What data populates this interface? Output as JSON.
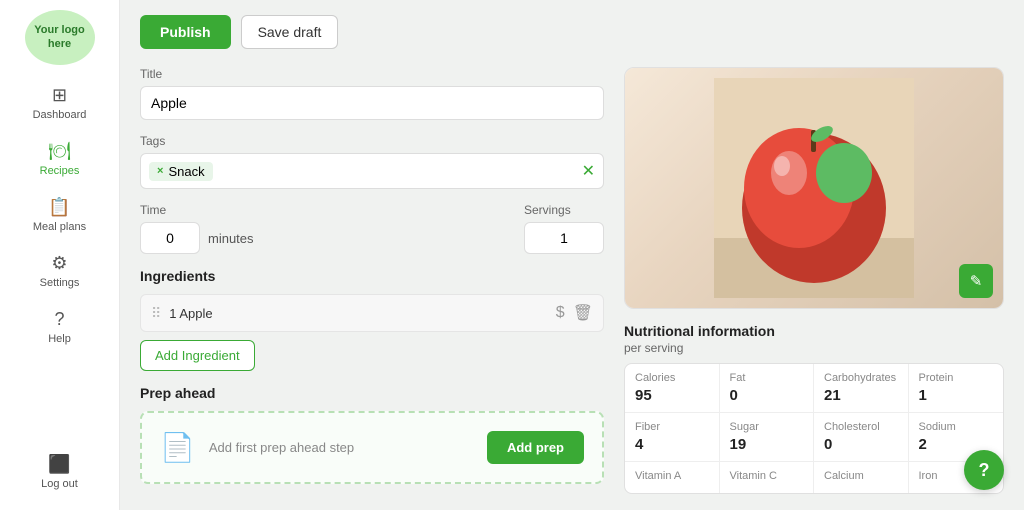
{
  "logo": {
    "text": "Your logo here"
  },
  "sidebar": {
    "items": [
      {
        "id": "dashboard",
        "label": "Dashboard",
        "icon": "⊞",
        "active": false
      },
      {
        "id": "recipes",
        "label": "Recipes",
        "icon": "🍽",
        "active": true
      },
      {
        "id": "mealplans",
        "label": "Meal plans",
        "icon": "📋",
        "active": false
      },
      {
        "id": "settings",
        "label": "Settings",
        "icon": "⚙",
        "active": false
      },
      {
        "id": "help",
        "label": "Help",
        "icon": "?",
        "active": false
      },
      {
        "id": "logout",
        "label": "Log out",
        "icon": "→",
        "active": false
      }
    ]
  },
  "toolbar": {
    "publish_label": "Publish",
    "save_draft_label": "Save draft"
  },
  "form": {
    "title_label": "Title",
    "title_value": "Apple",
    "title_placeholder": "",
    "tags_label": "Tags",
    "tags": [
      {
        "text": "Snack"
      }
    ],
    "tags_add_icon": "✕",
    "time_label": "Time",
    "time_value": "0",
    "minutes_label": "minutes",
    "servings_label": "Servings",
    "servings_value": "1"
  },
  "ingredients": {
    "section_title": "Ingredients",
    "items": [
      {
        "text": "1 Apple"
      }
    ],
    "add_button_label": "Add Ingredient"
  },
  "prep_ahead": {
    "section_title": "Prep ahead",
    "empty_text": "Add first prep ahead step",
    "add_button_label": "Add prep"
  },
  "image": {
    "edit_icon": "✎"
  },
  "nutrition": {
    "title": "Nutritional information",
    "per_serving": "per serving",
    "rows": [
      [
        {
          "label": "Calories",
          "value": "95"
        },
        {
          "label": "Fat",
          "value": "0"
        },
        {
          "label": "Carbohydrates",
          "value": "21"
        },
        {
          "label": "Protein",
          "value": "1"
        }
      ],
      [
        {
          "label": "Fiber",
          "value": "4"
        },
        {
          "label": "Sugar",
          "value": "19"
        },
        {
          "label": "Cholesterol",
          "value": "0"
        },
        {
          "label": "Sodium",
          "value": "2"
        }
      ],
      [
        {
          "label": "Vitamin A",
          "value": ""
        },
        {
          "label": "Vitamin C",
          "value": ""
        },
        {
          "label": "Calcium",
          "value": ""
        },
        {
          "label": "Iron",
          "value": ""
        }
      ]
    ]
  },
  "help_fab": {
    "label": "?"
  },
  "colors": {
    "green": "#3aaa35",
    "green_light": "#c8f0c0"
  }
}
